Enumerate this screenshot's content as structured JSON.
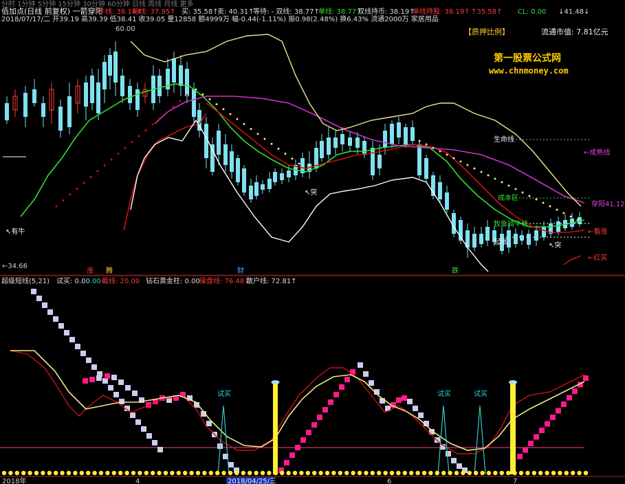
{
  "header": {
    "tabs_line": "分时  1分钟  5分钟  15分钟  30分钟  60分钟  日线  周线  月线  更多",
    "stock_title": "佰加点(日线 前复权) 一箭穿阳",
    "line1_items": [
      {
        "text": "牛线: 38.19↑",
        "color": "#ff3a3a"
      },
      {
        "text": "马线: 37.95↑",
        "color": "#ff3a3a"
      },
      {
        "text": "买: 35.58↑",
        "color": "#dddddd"
      },
      {
        "text": "卖: 40.31↑",
        "color": "#dddddd"
      },
      {
        "text": "等待: - 双线: 38.77↑",
        "color": "#dddddd"
      },
      {
        "text": "单线: 38.77↑",
        "color": "#33dd33"
      },
      {
        "text": "双线持币: 38.19↑",
        "color": "#dddddd"
      },
      {
        "text": "单线持股: 38.19↑",
        "color": "#ff3a3a"
      },
      {
        "text": "↑35.58↑",
        "color": "#ff3a3a"
      },
      {
        "text": "CL: 0.00",
        "color": "#33dd33"
      },
      {
        "text": "↓41.48↓",
        "color": "#dddddd"
      }
    ],
    "line2": "2018/07/17/二 开39.19 高39.39 低38.41 收39.05 量12858 额4999万 幅-0.44(-1.11%) 振0.98(2.48%) 换6.43% 流通2000万 家居用品"
  },
  "main_panel": {
    "pledge_button": "【质押比例】",
    "float_value": "流通市值: 7.81亿元",
    "watermark_title": "第一股票公式网",
    "watermark_url": "www.chnmoney.com",
    "high_label": "60.00",
    "low_label": "←34.66",
    "labels": [
      {
        "text": "生命线",
        "color": "#eeeeee"
      },
      {
        "text": "←成熟线",
        "color": "#dd44dd"
      },
      {
        "text": "成本区",
        "color": "#33dd33"
      },
      {
        "text": "穿阳41.12",
        "color": "#dd44dd"
      },
      {
        "text": "牧鱼骑牛线",
        "color": "#33dd33"
      },
      {
        "text": "←看涨",
        "color": "#ff3a3a"
      },
      {
        "text": "起涨",
        "color": "#eeeeee"
      },
      {
        "text": "↖突",
        "color": "#eeeeee"
      },
      {
        "text": "↖突",
        "color": "#eeeeee"
      },
      {
        "text": "←红买",
        "color": "#ff3a3a"
      },
      {
        "text": "↖有牛",
        "color": "#eeeeee"
      }
    ],
    "markers": [
      {
        "text": "涨",
        "color": "#ff3a3a"
      },
      {
        "text": "腾",
        "color": "#ffcc33"
      },
      {
        "text": "财",
        "color": "#55aaff"
      },
      {
        "text": "跌",
        "color": "#33dd33"
      }
    ]
  },
  "sub_panel": {
    "header_items": [
      {
        "text": "超级短线(5,21)",
        "color": "#dddddd"
      },
      {
        "text": "试买: 0.00",
        "color": "#dddddd"
      },
      {
        "text": ": 0.00",
        "color": "#33cccc"
      },
      {
        "text": "截线: 20.00",
        "color": "#ff3a3a"
      },
      {
        "text": "钻石黄金柱: 0.00",
        "color": "#dddddd"
      },
      {
        "text": "操盘线: 76.48↓",
        "color": "#ff3a3a"
      },
      {
        "text": "散户线: 72.81↑",
        "color": "#dddddd"
      }
    ],
    "trial_buy_label": "试买"
  },
  "axis": {
    "ticks": [
      "2018年",
      "4",
      "2018/04/25/三",
      "6",
      "7"
    ]
  },
  "colors": {
    "background": "#000000",
    "up": "#ff3a3a",
    "down": "#7fe0f0",
    "green_line": "#33dd33",
    "red_line": "#cc1111",
    "yellow_line": "#f0e68c",
    "magenta_line": "#cc33cc",
    "white_line": "#ffffff",
    "pink_block": "#ff1a8c",
    "lavender_block": "#ccccee",
    "gold": "#ffcc00"
  }
}
